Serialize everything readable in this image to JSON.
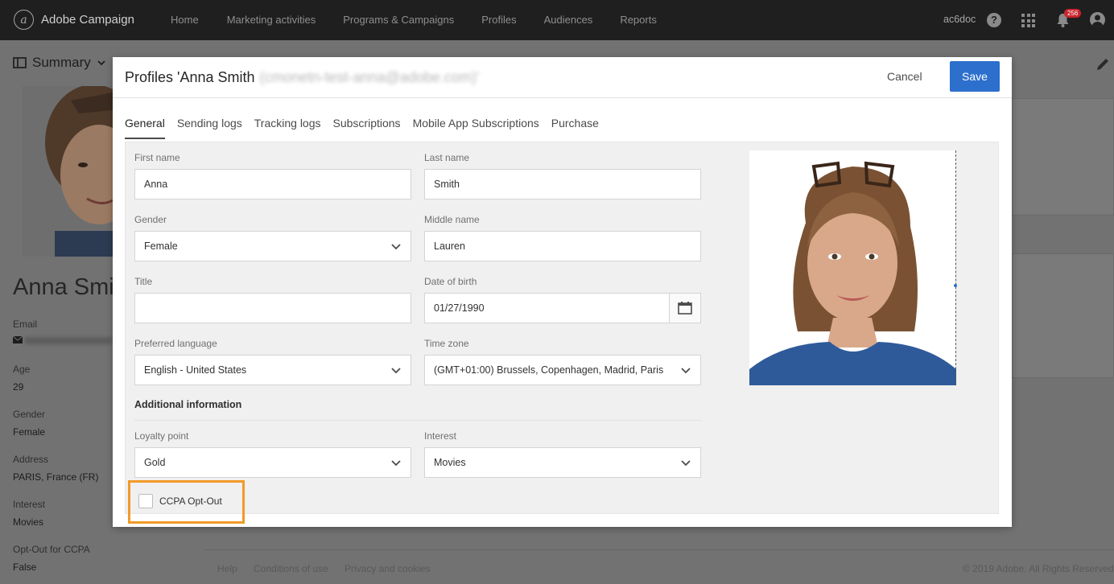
{
  "app": {
    "title": "Adobe Campaign",
    "user": "ac6doc",
    "notification_count": "256"
  },
  "nav": [
    "Home",
    "Marketing activities",
    "Programs & Campaigns",
    "Profiles",
    "Audiences",
    "Reports"
  ],
  "background": {
    "summary_label": "Summary",
    "name": "Anna Smith",
    "fields": [
      {
        "label": "Email",
        "value": ""
      },
      {
        "label": "Age",
        "value": "29"
      },
      {
        "label": "Gender",
        "value": "Female"
      },
      {
        "label": "Address",
        "value": "PARIS, France (FR)"
      },
      {
        "label": "Interest",
        "value": "Movies"
      },
      {
        "label": "Opt-Out for CCPA",
        "value": "False"
      }
    ],
    "footer": {
      "help": "Help",
      "conditions": "Conditions of use",
      "privacy": "Privacy and cookies",
      "copyright": "© 2019 Adobe. All Rights Reserved"
    }
  },
  "modal": {
    "title": "Profiles 'Anna Smith",
    "title_blurred": "(cmonetn-test-anna@adobe.com)'",
    "cancel_label": "Cancel",
    "save_label": "Save",
    "tabs": [
      "General",
      "Sending logs",
      "Tracking logs",
      "Subscriptions",
      "Mobile App Subscriptions",
      "Purchase"
    ],
    "active_tab": "General",
    "form": {
      "first_name": {
        "label": "First name",
        "value": "Anna"
      },
      "last_name": {
        "label": "Last name",
        "value": "Smith"
      },
      "gender": {
        "label": "Gender",
        "value": "Female"
      },
      "middle_name": {
        "label": "Middle name",
        "value": "Lauren"
      },
      "title": {
        "label": "Title",
        "value": ""
      },
      "date_of_birth": {
        "label": "Date of birth",
        "value": "01/27/1990"
      },
      "preferred_language": {
        "label": "Preferred language",
        "value": "English - United States"
      },
      "time_zone": {
        "label": "Time zone",
        "value": "(GMT+01:00) Brussels, Copenhagen, Madrid, Paris"
      },
      "additional_title": "Additional information",
      "loyalty_point": {
        "label": "Loyalty point",
        "value": "Gold"
      },
      "interest": {
        "label": "Interest",
        "value": "Movies"
      },
      "ccpa_opt_out": {
        "label": "CCPA Opt-Out",
        "checked": false
      }
    }
  },
  "colors": {
    "accent": "#2d6fcc",
    "highlight": "#f19a28",
    "topbar": "#1f1f1f"
  },
  "icons": [
    "logo-icon",
    "help-icon",
    "apps-grid-icon",
    "bell-icon",
    "avatar-icon",
    "sidebar-toggle-icon",
    "chevron-down-icon",
    "pencil-icon",
    "calendar-icon",
    "mail-icon"
  ]
}
